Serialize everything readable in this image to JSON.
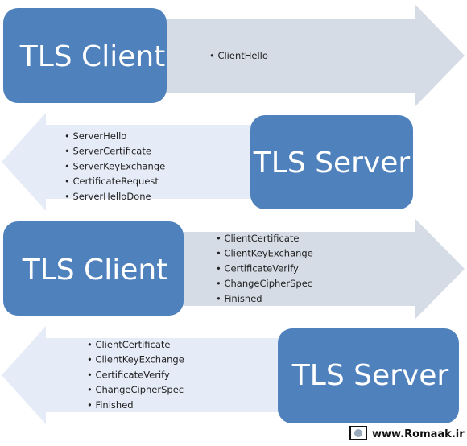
{
  "rows": [
    {
      "direction": "right",
      "box": "TLS Client",
      "messages": [
        "ClientHello"
      ]
    },
    {
      "direction": "left",
      "box": "TLS Server",
      "messages": [
        "ServerHello",
        "ServerCertificate",
        "ServerKeyExchange",
        "CertificateRequest",
        "ServerHelloDone"
      ]
    },
    {
      "direction": "right",
      "box": "TLS Client",
      "messages": [
        "ClientCertificate",
        "ClientKeyExchange",
        "CertificateVerify",
        "ChangeCipherSpec",
        "Finished"
      ]
    },
    {
      "direction": "left",
      "box": "TLS Server",
      "messages": [
        "ClientCertificate",
        "ClientKeyExchange",
        "CertificateVerify",
        "ChangeCipherSpec",
        "Finished"
      ]
    }
  ],
  "colors": {
    "box": "#4f81bd",
    "arrow_right": "#d6dce6",
    "arrow_left": "#e6ecf7"
  },
  "watermark": "www.Romaak.ir"
}
